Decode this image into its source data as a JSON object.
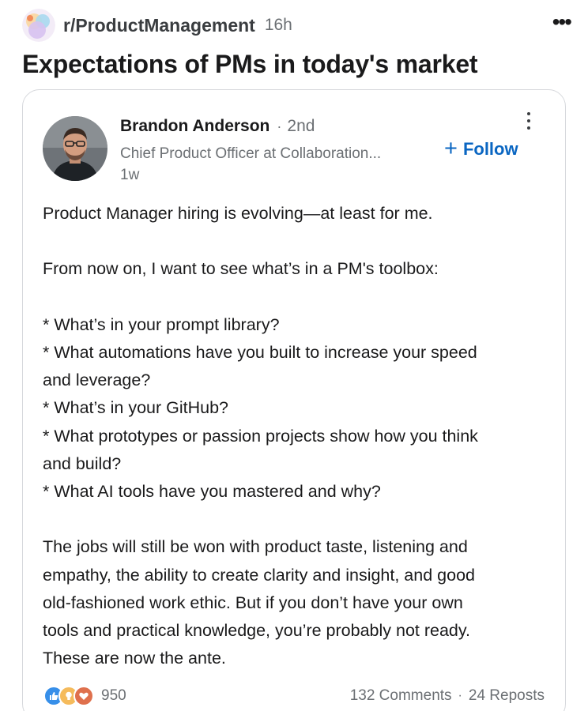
{
  "subreddit": {
    "name": "r/ProductManagement",
    "age": "16h",
    "icon": "subreddit-community-icon",
    "more_icon": "more-horizontal-icon"
  },
  "post": {
    "title": "Expectations of PMs in today's market"
  },
  "embed": {
    "author": {
      "name": "Brandon Anderson",
      "degree_separator": "·",
      "degree": "2nd",
      "headline": "Chief Product Officer at Collaboration...",
      "time_ago": "1w",
      "avatar_icon": "profile-photo"
    },
    "follow_label": "Follow",
    "follow_icon": "plus-icon",
    "menu_icon": "more-vertical-icon",
    "body": {
      "line1": "Product Manager hiring is evolving—at least for me.",
      "line2": "From now on, I want to see what’s in a PM's toolbox:",
      "b1": "* What’s in your prompt library?",
      "b2a": "* What automations have you built to increase your speed",
      "b2b": "and leverage?",
      "b3": "* What’s in your GitHub?",
      "b4a": "* What prototypes or passion projects show how you think",
      "b4b": "and build?",
      "b5": "* What AI tools have you mastered and why?",
      "p3a": "The jobs will still be won with product taste, listening and",
      "p3b": "empathy, the ability to create clarity and insight, and good",
      "p3c": "old-fashioned work ethic.  But if you don’t have your own",
      "p3d": "tools and practical knowledge, you’re probably not ready.",
      "p3e": "These are now the ante."
    },
    "reactions": {
      "icons": [
        "like-reaction-icon",
        "insightful-reaction-icon",
        "love-reaction-icon"
      ],
      "count": "950"
    },
    "stats": {
      "comments": "132 Comments",
      "separator": "·",
      "reposts": "24 Reposts"
    },
    "colors": {
      "link": "#0a66c2",
      "like": "#378fe9",
      "insight": "#f5bb5c",
      "love": "#df704d"
    }
  }
}
